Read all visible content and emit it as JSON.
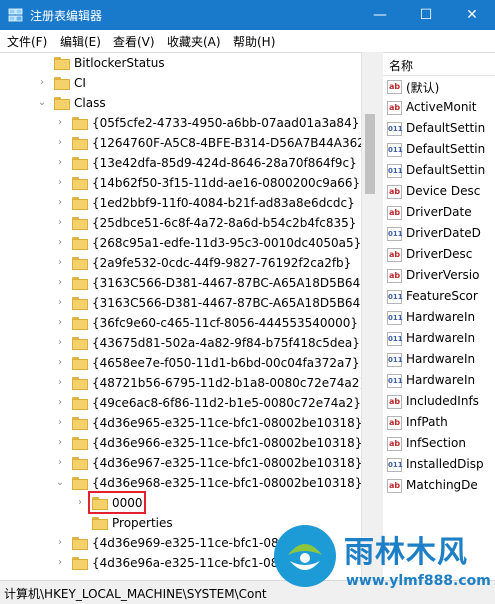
{
  "window": {
    "title": "注册表编辑器",
    "controls": {
      "minimize": "—",
      "maximize": "☐",
      "close": "✕"
    }
  },
  "menu": [
    "文件(F)",
    "编辑(E)",
    "查看(V)",
    "收藏夹(A)",
    "帮助(H)"
  ],
  "tree": [
    {
      "label": "BitlockerStatus",
      "level": 0,
      "expander": "none"
    },
    {
      "label": "CI",
      "level": 0,
      "expander": "collapsed"
    },
    {
      "label": "Class",
      "level": 0,
      "expander": "expanded"
    },
    {
      "label": "{05f5cfe2-4733-4950-a6bb-07aad01a3a84}",
      "level": 1,
      "expander": "collapsed"
    },
    {
      "label": "{1264760F-A5C8-4BFE-B314-D56A7B44A362}",
      "level": 1,
      "expander": "collapsed"
    },
    {
      "label": "{13e42dfa-85d9-424d-8646-28a70f864f9c}",
      "level": 1,
      "expander": "collapsed"
    },
    {
      "label": "{14b62f50-3f15-11dd-ae16-0800200c9a66}",
      "level": 1,
      "expander": "collapsed"
    },
    {
      "label": "{1ed2bbf9-11f0-4084-b21f-ad83a8e6dcdc}",
      "level": 1,
      "expander": "collapsed"
    },
    {
      "label": "{25dbce51-6c8f-4a72-8a6d-b54c2b4fc835}",
      "level": 1,
      "expander": "collapsed"
    },
    {
      "label": "{268c95a1-edfe-11d3-95c3-0010dc4050a5}",
      "level": 1,
      "expander": "collapsed"
    },
    {
      "label": "{2a9fe532-0cdc-44f9-9827-76192f2ca2fb}",
      "level": 1,
      "expander": "collapsed"
    },
    {
      "label": "{3163C566-D381-4467-87BC-A65A18D5B648}",
      "level": 1,
      "expander": "collapsed"
    },
    {
      "label": "{3163C566-D381-4467-87BC-A65A18D5B649}",
      "level": 1,
      "expander": "collapsed"
    },
    {
      "label": "{36fc9e60-c465-11cf-8056-444553540000}",
      "level": 1,
      "expander": "collapsed"
    },
    {
      "label": "{43675d81-502a-4a82-9f84-b75f418c5dea}",
      "level": 1,
      "expander": "collapsed"
    },
    {
      "label": "{4658ee7e-f050-11d1-b6bd-00c04fa372a7}",
      "level": 1,
      "expander": "collapsed"
    },
    {
      "label": "{48721b56-6795-11d2-b1a8-0080c72e74a2}",
      "level": 1,
      "expander": "collapsed"
    },
    {
      "label": "{49ce6ac8-6f86-11d2-b1e5-0080c72e74a2}",
      "level": 1,
      "expander": "collapsed"
    },
    {
      "label": "{4d36e965-e325-11ce-bfc1-08002be10318}",
      "level": 1,
      "expander": "collapsed"
    },
    {
      "label": "{4d36e966-e325-11ce-bfc1-08002be10318}",
      "level": 1,
      "expander": "collapsed"
    },
    {
      "label": "{4d36e967-e325-11ce-bfc1-08002be10318}",
      "level": 1,
      "expander": "collapsed"
    },
    {
      "label": "{4d36e968-e325-11ce-bfc1-08002be10318}",
      "level": 1,
      "expander": "expanded"
    },
    {
      "label": "0000",
      "level": 2,
      "expander": "collapsed",
      "highlighted": true
    },
    {
      "label": "Properties",
      "level": 2,
      "expander": "none"
    },
    {
      "label": "{4d36e969-e325-11ce-bfc1-08",
      "level": 1,
      "expander": "collapsed"
    },
    {
      "label": "{4d36e96a-e325-11ce-bfc1-08",
      "level": 1,
      "expander": "collapsed"
    }
  ],
  "values": {
    "header": "名称",
    "items": [
      {
        "name": "(默认)",
        "type": "string"
      },
      {
        "name": "ActiveMonit",
        "type": "string"
      },
      {
        "name": "DefaultSettin",
        "type": "binary"
      },
      {
        "name": "DefaultSettin",
        "type": "binary"
      },
      {
        "name": "DefaultSettin",
        "type": "binary"
      },
      {
        "name": "Device Desc",
        "type": "string"
      },
      {
        "name": "DriverDate",
        "type": "string"
      },
      {
        "name": "DriverDateD",
        "type": "binary"
      },
      {
        "name": "DriverDesc",
        "type": "string"
      },
      {
        "name": "DriverVersio",
        "type": "string"
      },
      {
        "name": "FeatureScor",
        "type": "binary"
      },
      {
        "name": "HardwareIn",
        "type": "binary"
      },
      {
        "name": "HardwareIn",
        "type": "binary"
      },
      {
        "name": "HardwareIn",
        "type": "binary"
      },
      {
        "name": "HardwareIn",
        "type": "binary"
      },
      {
        "name": "IncludedInfs",
        "type": "string"
      },
      {
        "name": "InfPath",
        "type": "string"
      },
      {
        "name": "InfSection",
        "type": "string"
      },
      {
        "name": "InstalledDisp",
        "type": "binary"
      },
      {
        "name": "MatchingDe",
        "type": "string"
      }
    ]
  },
  "status": "计算机\\HKEY_LOCAL_MACHINE\\SYSTEM\\Cont",
  "watermark": {
    "name": "雨林木风",
    "url": "www.ylmf888.com"
  },
  "colors": {
    "titlebar": "#1979ca",
    "highlight": "#e3202e",
    "watermark": "#1d7fc5"
  }
}
